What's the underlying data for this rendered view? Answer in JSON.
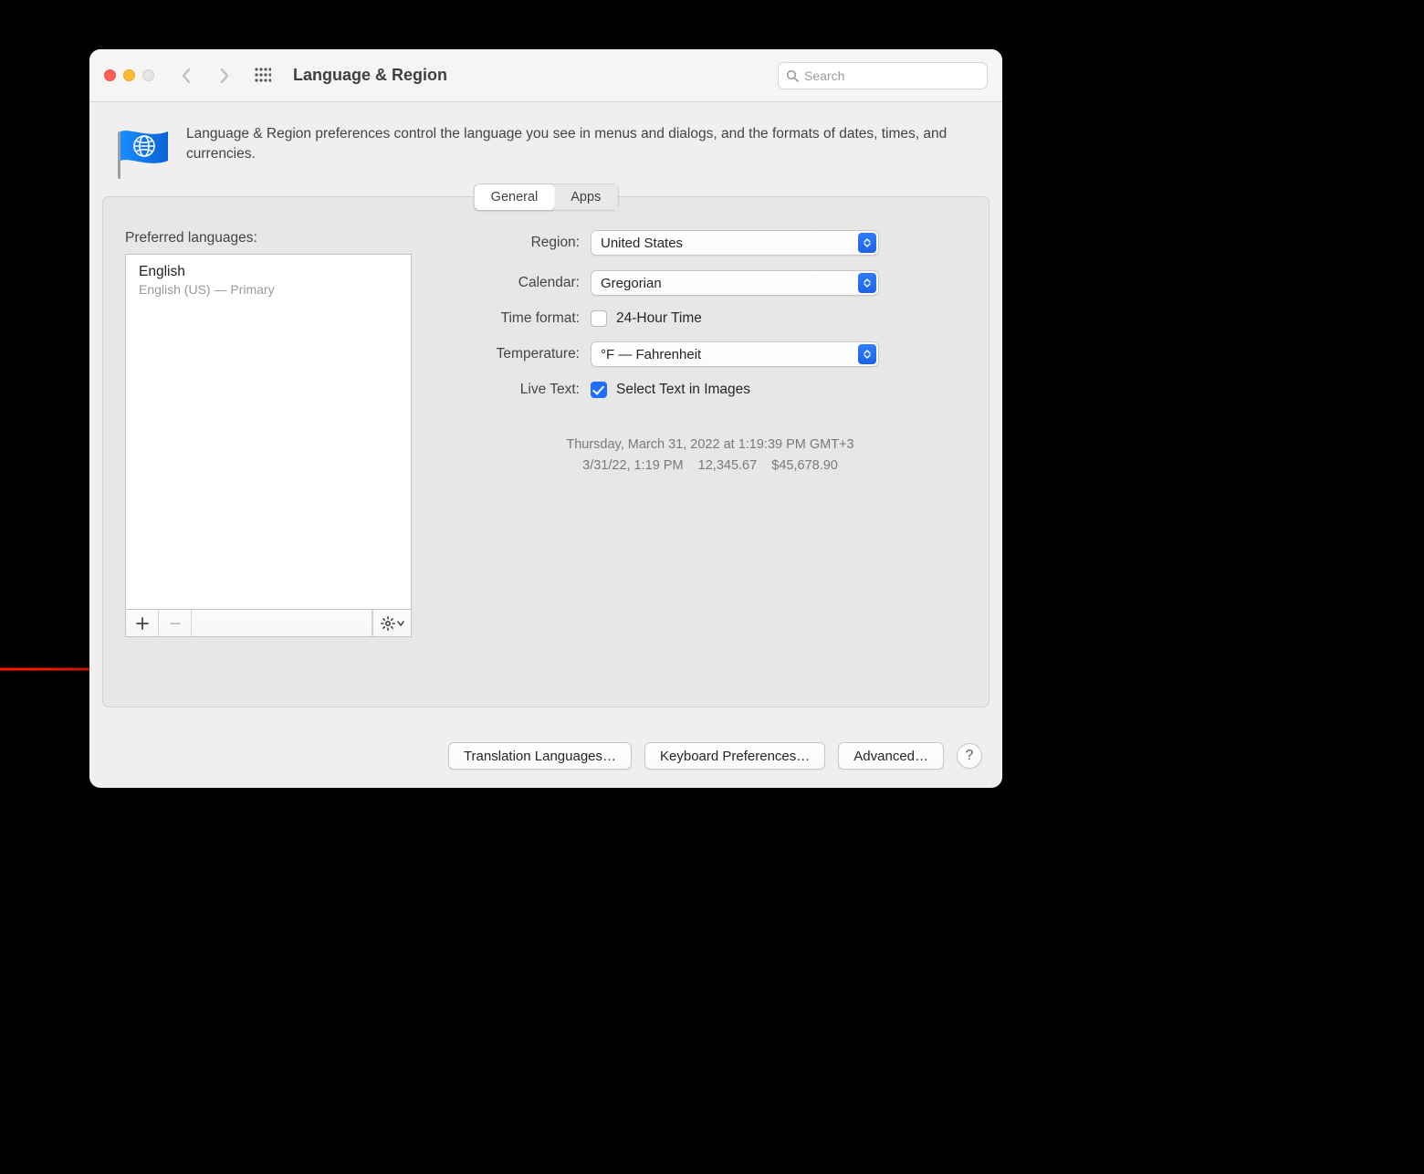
{
  "window": {
    "title": "Language & Region",
    "search_placeholder": "Search"
  },
  "description": "Language & Region preferences control the language you see in menus and dialogs, and the formats of dates, times, and currencies.",
  "tabs": {
    "general": "General",
    "apps": "Apps"
  },
  "left": {
    "heading": "Preferred languages:",
    "items": [
      {
        "name": "English",
        "sub": "English (US) — Primary"
      }
    ]
  },
  "form": {
    "region_label": "Region:",
    "region_value": "United States",
    "calendar_label": "Calendar:",
    "calendar_value": "Gregorian",
    "time_label": "Time format:",
    "time_value": "24-Hour Time",
    "temp_label": "Temperature:",
    "temp_value": "°F — Fahrenheit",
    "livetext_label": "Live Text:",
    "livetext_value": "Select Text in Images"
  },
  "example": {
    "line1": "Thursday, March 31, 2022 at 1:19:39 PM GMT+3",
    "line2": "3/31/22, 1:19 PM    12,345.67    $45,678.90"
  },
  "footer": {
    "translation": "Translation Languages…",
    "keyboard": "Keyboard Preferences…",
    "advanced": "Advanced…",
    "help": "?"
  }
}
